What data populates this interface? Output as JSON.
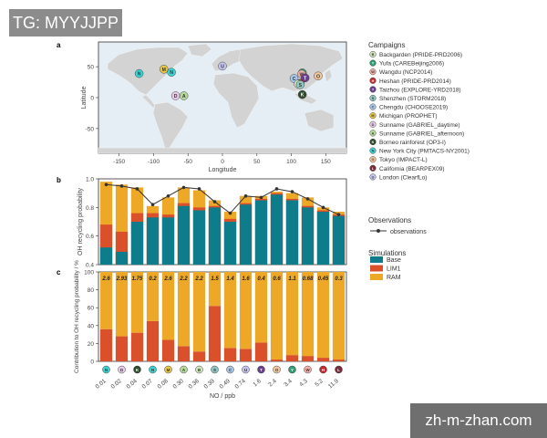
{
  "watermark_top": "TG: MYYJJPP",
  "watermark_bottom": "zh-m-zhan.com",
  "colors": {
    "base": "#0f7c8c",
    "lim1": "#d9502a",
    "ram": "#eda828",
    "land": "#d3d3d3",
    "ocean": "#e4eef4",
    "line": "#333333"
  },
  "panels": {
    "a": "a",
    "b": "b",
    "c": "c"
  },
  "map": {
    "xlabel": "Longitude",
    "ylabel": "Latitude",
    "xticks": [
      "-150",
      "-100",
      "-50",
      "0",
      "50",
      "100",
      "150"
    ],
    "yticks": [
      "50",
      "0",
      "-50"
    ]
  },
  "campaigns_title": "Campaigns",
  "campaigns": [
    {
      "code": "B",
      "color": "#cfe6bd",
      "label": "Backgarden (PRIDE-PRD2006)"
    },
    {
      "code": "Y",
      "color": "#2e9c73",
      "label": "Yufa (CAREBeijing2006)"
    },
    {
      "code": "W",
      "color": "#f2b0a8",
      "label": "Wangdu (NCP2014)"
    },
    {
      "code": "H",
      "color": "#c1272d",
      "label": "Heshan (PRIDE-PRD2014)"
    },
    {
      "code": "T",
      "color": "#6a3d8f",
      "label": "Taizhou (EXPLORE-YRD2018)"
    },
    {
      "code": "S",
      "color": "#8fc7c2",
      "label": "Shenzhen (STORM2018)"
    },
    {
      "code": "C",
      "color": "#a9c7e8",
      "label": "Chengdu (CHOOSE2019)"
    },
    {
      "code": "M",
      "color": "#e8c845",
      "label": "Michigan (PROPHET)"
    },
    {
      "code": "D",
      "color": "#e8cbe8",
      "label": "Sunname (GABRIEL_daytime)"
    },
    {
      "code": "A",
      "color": "#b5d99c",
      "label": "Sunname (GABRIEL_afternoon)"
    },
    {
      "code": "K",
      "color": "#2d4a2b",
      "label": "Borneo rainforest (OP3-I)"
    },
    {
      "code": "N",
      "color": "#3fd2d2",
      "label": "New York City (PMTACS-NY2001)"
    },
    {
      "code": "O",
      "color": "#f2c79b",
      "label": "Tokyo (IMPACT-L)"
    },
    {
      "code": "L",
      "color": "#7a2a3a",
      "label": "California (BEARPEX09)"
    },
    {
      "code": "U",
      "color": "#c4c4f0",
      "label": "London (ClearfLo)"
    }
  ],
  "map_markers": [
    {
      "code": "N",
      "lon": -121,
      "lat": 39
    },
    {
      "code": "M",
      "lon": -85,
      "lat": 46
    },
    {
      "code": "N",
      "lon": -74,
      "lat": 41
    },
    {
      "code": "D",
      "lon": -68,
      "lat": 3
    },
    {
      "code": "A",
      "lon": -56,
      "lat": 3
    },
    {
      "code": "U",
      "lon": 0,
      "lat": 51
    },
    {
      "code": "Y",
      "lon": 116,
      "lat": 40
    },
    {
      "code": "W",
      "lon": 115,
      "lat": 38
    },
    {
      "code": "C",
      "lon": 104,
      "lat": 31
    },
    {
      "code": "T",
      "lon": 120,
      "lat": 32
    },
    {
      "code": "H",
      "lon": 113,
      "lat": 23
    },
    {
      "code": "B",
      "lon": 110,
      "lat": 22
    },
    {
      "code": "S",
      "lon": 113,
      "lat": 21
    },
    {
      "code": "O",
      "lon": 139,
      "lat": 35
    },
    {
      "code": "K",
      "lon": 116,
      "lat": 5
    }
  ],
  "legend_obs_title": "Observations",
  "legend_obs_item": "observations",
  "legend_sim_title": "Simulations",
  "legend_sim_items": [
    "Base",
    "LIM1",
    "RAM"
  ],
  "chart_data": [
    {
      "type": "bar",
      "panel": "b",
      "ylabel": "OH recycling probability",
      "ylim": [
        0.4,
        1.0
      ],
      "yticks": [
        "0.4",
        "0.6",
        "0.8",
        "1.0"
      ],
      "categories": [
        "N",
        "D",
        "K",
        "N",
        "M",
        "A",
        "B",
        "S",
        "C",
        "U",
        "T",
        "O",
        "Y",
        "W",
        "H",
        "L"
      ],
      "observations": [
        0.96,
        0.95,
        0.93,
        0.82,
        0.88,
        0.94,
        0.93,
        0.84,
        0.76,
        0.88,
        0.87,
        0.93,
        0.91,
        0.86,
        0.8,
        0.75
      ],
      "series": [
        {
          "name": "Base",
          "values": [
            0.52,
            0.49,
            0.7,
            0.73,
            0.73,
            0.81,
            0.78,
            0.8,
            0.7,
            0.82,
            0.85,
            0.89,
            0.85,
            0.8,
            0.77,
            0.74
          ]
        },
        {
          "name": "LIM1",
          "values": [
            0.68,
            0.63,
            0.76,
            0.76,
            0.75,
            0.83,
            0.8,
            0.81,
            0.72,
            0.83,
            0.86,
            0.9,
            0.86,
            0.81,
            0.78,
            0.75
          ]
        },
        {
          "name": "RAM",
          "values": [
            0.98,
            0.96,
            0.94,
            0.81,
            0.87,
            0.94,
            0.92,
            0.85,
            0.77,
            0.88,
            0.88,
            0.91,
            0.9,
            0.87,
            0.8,
            0.77
          ]
        }
      ]
    },
    {
      "type": "bar",
      "panel": "c",
      "ylabel": "Contribution to OH recycling probability / %",
      "xlabel": "NO / ppb",
      "ylim": [
        0,
        100
      ],
      "yticks": [
        "0",
        "20",
        "40",
        "60",
        "80",
        "100"
      ],
      "categories": [
        "0.01",
        "0.02",
        "0.04",
        "0.07",
        "0.08",
        "0.30",
        "0.36",
        "0.39",
        "0.49",
        "0.74",
        "1.6",
        "2.4",
        "3.4",
        "4.3",
        "5.2",
        "11.9"
      ],
      "markers": [
        "N",
        "D",
        "K",
        "N",
        "M",
        "A",
        "B",
        "S",
        "C",
        "U",
        "T",
        "O",
        "Y",
        "W",
        "H",
        "L"
      ],
      "ratio_labels": [
        "2.6",
        "2.93",
        "1.75",
        "0.2",
        "2.6",
        "2.2",
        "2.2",
        "1.5",
        "1.4",
        "1.6",
        "0.4",
        "0.6",
        "1.1",
        "0.68",
        "0.45",
        "0.3"
      ],
      "series": [
        {
          "name": "LIM1",
          "values": [
            36,
            28,
            32,
            45,
            24,
            17,
            11,
            62,
            15,
            14,
            21,
            2,
            7,
            6,
            4,
            2
          ]
        },
        {
          "name": "RAM",
          "values": [
            64,
            72,
            68,
            55,
            76,
            83,
            89,
            38,
            85,
            86,
            79,
            98,
            93,
            94,
            96,
            98
          ]
        }
      ]
    }
  ]
}
